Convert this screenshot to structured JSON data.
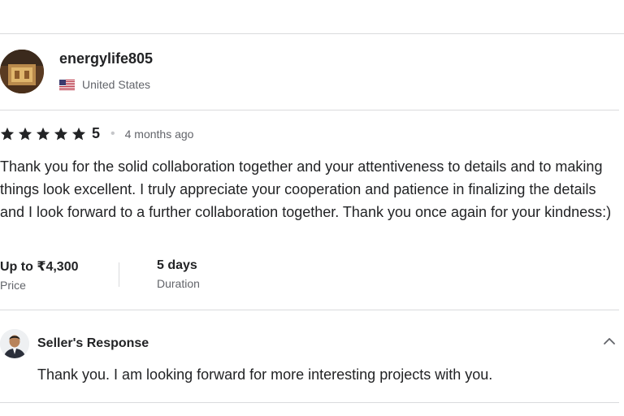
{
  "review": {
    "username": "energylife805",
    "country": "United States",
    "rating": "5",
    "time_ago": "4 months ago",
    "text": "Thank you for the solid collaboration together and your attentiveness to details and to making things look excellent. I truly appreciate your cooperation and patience in finalizing the details and I look forward to a further collaboration together. Thank you once again for your kindness:)",
    "price_value": "Up to ₹4,300",
    "price_label": "Price",
    "duration_value": "5 days",
    "duration_label": "Duration"
  },
  "seller_response": {
    "title": "Seller's Response",
    "text": "Thank you. I am looking forward for more interesting projects with you."
  },
  "icons": {
    "star": "star-icon",
    "flag": "us-flag-icon",
    "chevron": "chevron-up-icon"
  }
}
